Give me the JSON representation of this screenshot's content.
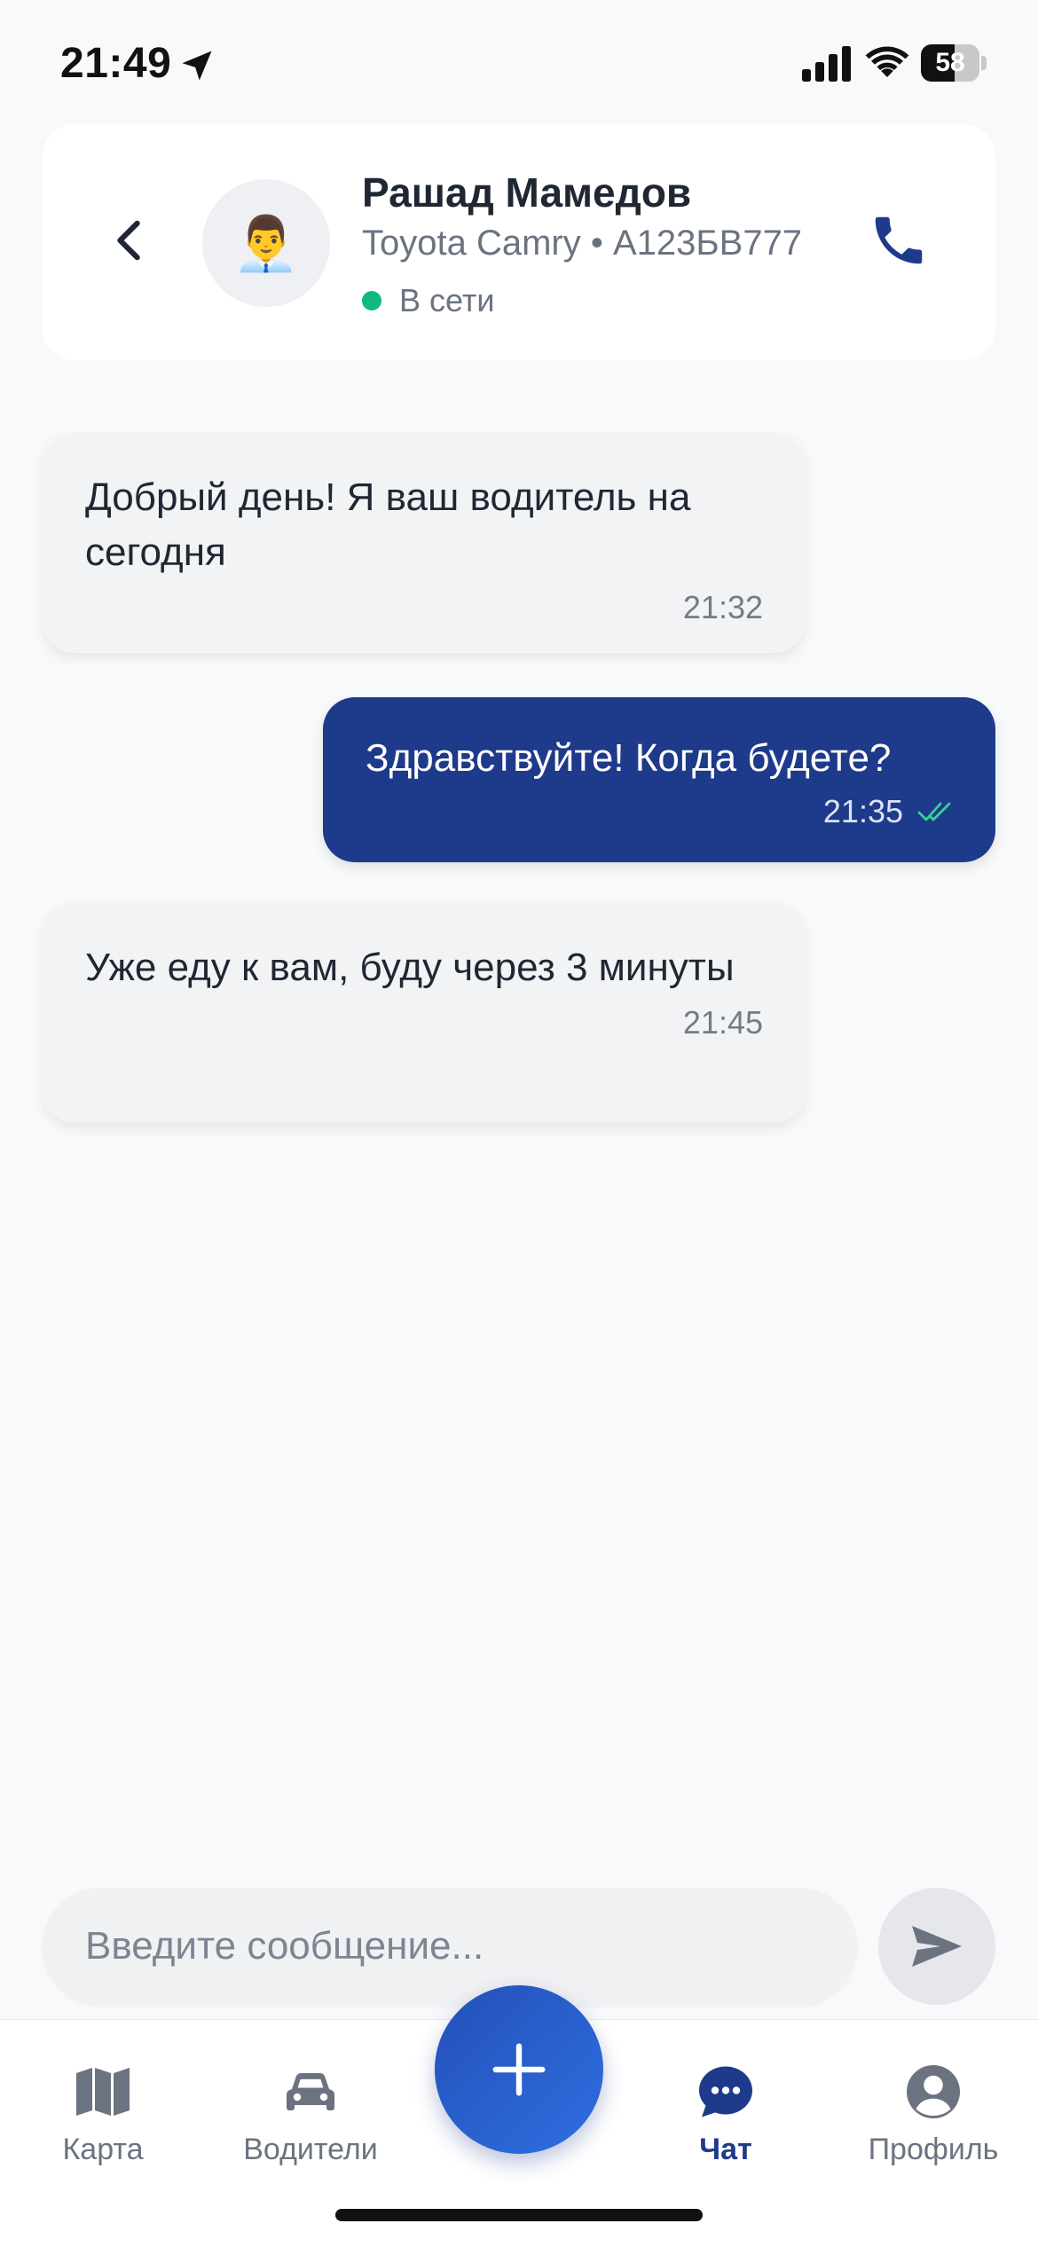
{
  "status_bar": {
    "time": "21:49",
    "battery": "58",
    "battery_level": 0.58
  },
  "header": {
    "name": "Рашад Мамедов",
    "vehicle": "Toyota Camry • А123БВ777",
    "status": "В сети",
    "avatar_emoji": "👨‍💼"
  },
  "messages": [
    {
      "direction": "incoming",
      "text": "Добрый день! Я ваш водитель на сегодня",
      "time": "21:32"
    },
    {
      "direction": "outgoing",
      "text": "Здравствуйте! Когда будете?",
      "time": "21:35",
      "read": true
    },
    {
      "direction": "incoming",
      "text": "Уже еду к вам, буду через 3 минуты",
      "time": "21:45"
    }
  ],
  "composer": {
    "placeholder": "Введите сообщение..."
  },
  "nav": {
    "items": [
      {
        "label": "Карта",
        "icon": "map-icon"
      },
      {
        "label": "Водители",
        "icon": "car-icon"
      },
      {
        "label": "Чат",
        "icon": "chat-icon",
        "active": true
      },
      {
        "label": "Профиль",
        "icon": "profile-icon"
      }
    ],
    "fab_icon": "plus-icon"
  },
  "colors": {
    "primary": "#1e3a8a",
    "online": "#10b981",
    "background": "#f8f9fb",
    "read_check": "#34d399"
  }
}
